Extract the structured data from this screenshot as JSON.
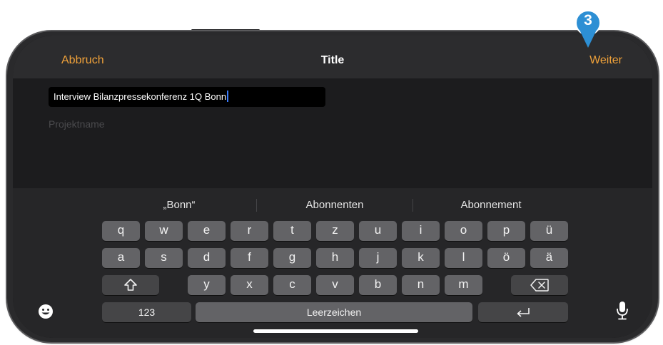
{
  "navbar": {
    "cancel_label": "Abbruch",
    "title": "Title",
    "next_label": "Weiter"
  },
  "form": {
    "field_value": "Interview Bilanzpressekonferenz 1Q Bonn",
    "field_label": "Projektname"
  },
  "keyboard": {
    "suggestions": [
      "„Bonn“",
      "Abonnenten",
      "Abonnement"
    ],
    "row1": [
      "q",
      "w",
      "e",
      "r",
      "t",
      "z",
      "u",
      "i",
      "o",
      "p",
      "ü"
    ],
    "row2": [
      "a",
      "s",
      "d",
      "f",
      "g",
      "h",
      "j",
      "k",
      "l",
      "ö",
      "ä"
    ],
    "row3": [
      "y",
      "x",
      "c",
      "v",
      "b",
      "n",
      "m"
    ],
    "numbers_label": "123",
    "space_label": "Leerzeichen",
    "shift_icon": "shift-icon",
    "delete_icon": "delete-icon",
    "return_icon": "return-icon",
    "emoji_icon": "emoji-icon",
    "mic_icon": "microphone-icon"
  },
  "annotation": {
    "step_number": "3",
    "color": "#2d8fd4"
  },
  "colors": {
    "accent": "#f0a23a",
    "caret": "#3a7bfd"
  }
}
